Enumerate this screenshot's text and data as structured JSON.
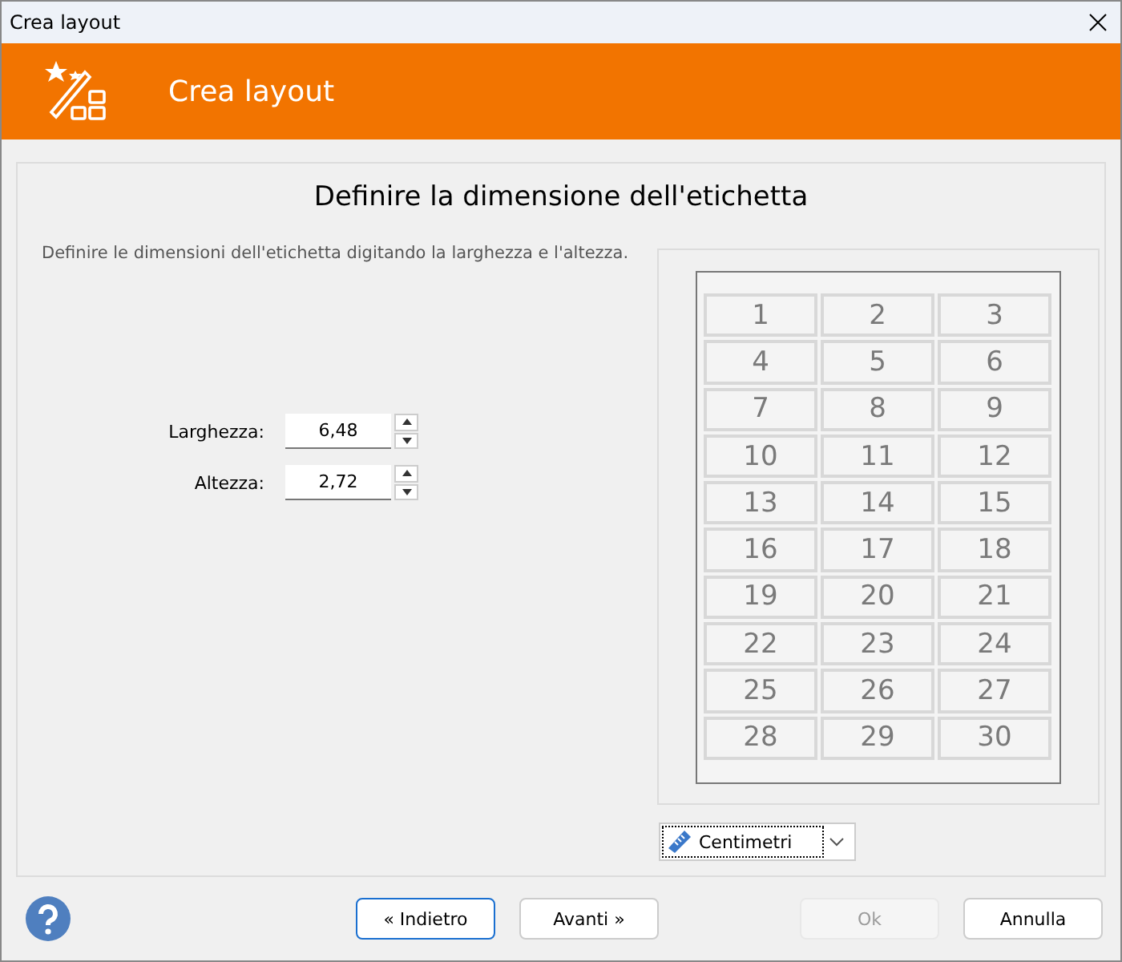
{
  "window": {
    "title": "Crea layout"
  },
  "header": {
    "title": "Crea layout"
  },
  "page": {
    "heading": "Definire la dimensione dell'etichetta",
    "description": "Definire le dimensioni dell'etichetta digitando la larghezza e l'altezza."
  },
  "fields": [
    {
      "label": "Larghezza:",
      "value": "6,48"
    },
    {
      "label": "Altezza:",
      "value": "2,72"
    }
  ],
  "preview": {
    "labels": [
      "1",
      "2",
      "3",
      "4",
      "5",
      "6",
      "7",
      "8",
      "9",
      "10",
      "11",
      "12",
      "13",
      "14",
      "15",
      "16",
      "17",
      "18",
      "19",
      "20",
      "21",
      "22",
      "23",
      "24",
      "25",
      "26",
      "27",
      "28",
      "29",
      "30"
    ]
  },
  "unit": {
    "value": "Centimetri"
  },
  "buttons": [
    {
      "label": "« Indietro",
      "disabled": false,
      "default": true
    },
    {
      "label": "Avanti »",
      "disabled": false,
      "default": false
    },
    {
      "label": "Ok",
      "disabled": true,
      "default": false
    },
    {
      "label": "Annulla",
      "disabled": false,
      "default": false
    }
  ]
}
